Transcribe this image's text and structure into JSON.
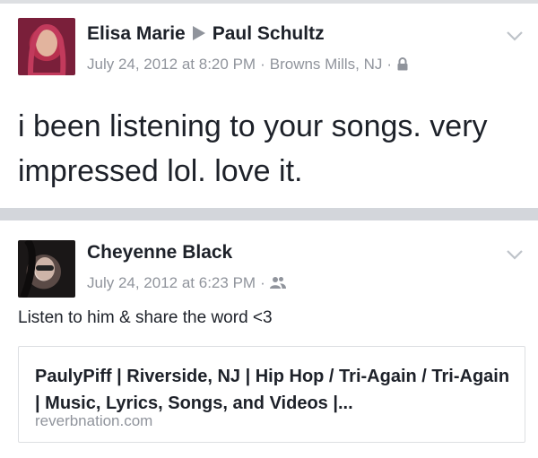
{
  "posts": [
    {
      "author": "Elisa Marie",
      "recipient": "Paul Schultz",
      "timestamp": "July 24, 2012 at 8:20 PM",
      "location": "Browns Mills, NJ",
      "privacy_icon": "lock-icon",
      "message": "i been listening to your songs. very impressed lol. love it."
    },
    {
      "author": "Cheyenne Black",
      "timestamp": "July 24, 2012 at 6:23 PM",
      "privacy_icon": "friends-icon",
      "message": "Listen to him & share the word <3",
      "link": {
        "title": "PaulyPiff | Riverside, NJ | Hip Hop / Tri-Again / Tri-Again | Music, Lyrics, Songs, and Videos |...",
        "domain": "reverbnation.com"
      }
    }
  ],
  "separator": "·",
  "colors": {
    "text": "#1d2129",
    "meta": "#90949c",
    "divider": "#d3d6db"
  }
}
